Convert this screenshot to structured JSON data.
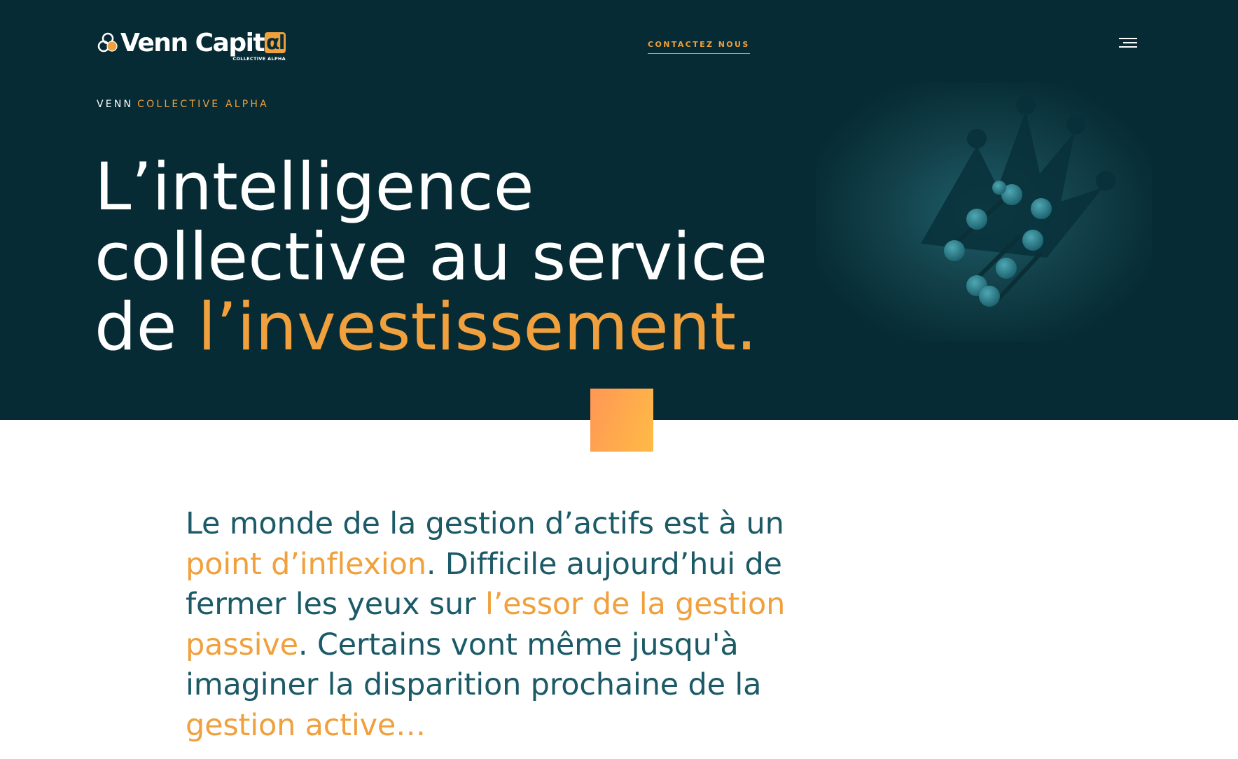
{
  "header": {
    "logo": {
      "text_main": "Venn Capit",
      "text_alpha": "αl",
      "subtitle": "COLLECTIVE ALPHA"
    },
    "contact_label": "CONTACTEZ NOUS",
    "menu_icon": "hamburger-menu-icon"
  },
  "hero": {
    "eyebrow_white": "VENN",
    "eyebrow_accent": "COLLECTIVE ALPHA",
    "headline_line1": "L’intelligence",
    "headline_line2": "collective au service",
    "headline_line3_prefix": "de ",
    "headline_line3_accent": "l’investissement.",
    "image_icon": "chess-pieces-image"
  },
  "intro": {
    "seg1": "Le monde de la gestion d’actifs est à un ",
    "seg2_accent": "point d’inflexion",
    "seg3": ". Difficile aujourd’hui de fermer les yeux sur ",
    "seg4_accent": "l’essor de la gestion passive",
    "seg5": ". Certains vont même jusqu'à imaginer la disparition prochaine de la ",
    "seg6_accent": "gestion active…"
  },
  "colors": {
    "hero_bg": "#062b34",
    "accent": "#f0a03c",
    "body_text": "#1b5a66",
    "square_gradient_start": "#ff9755",
    "square_gradient_end": "#ffbb45"
  }
}
